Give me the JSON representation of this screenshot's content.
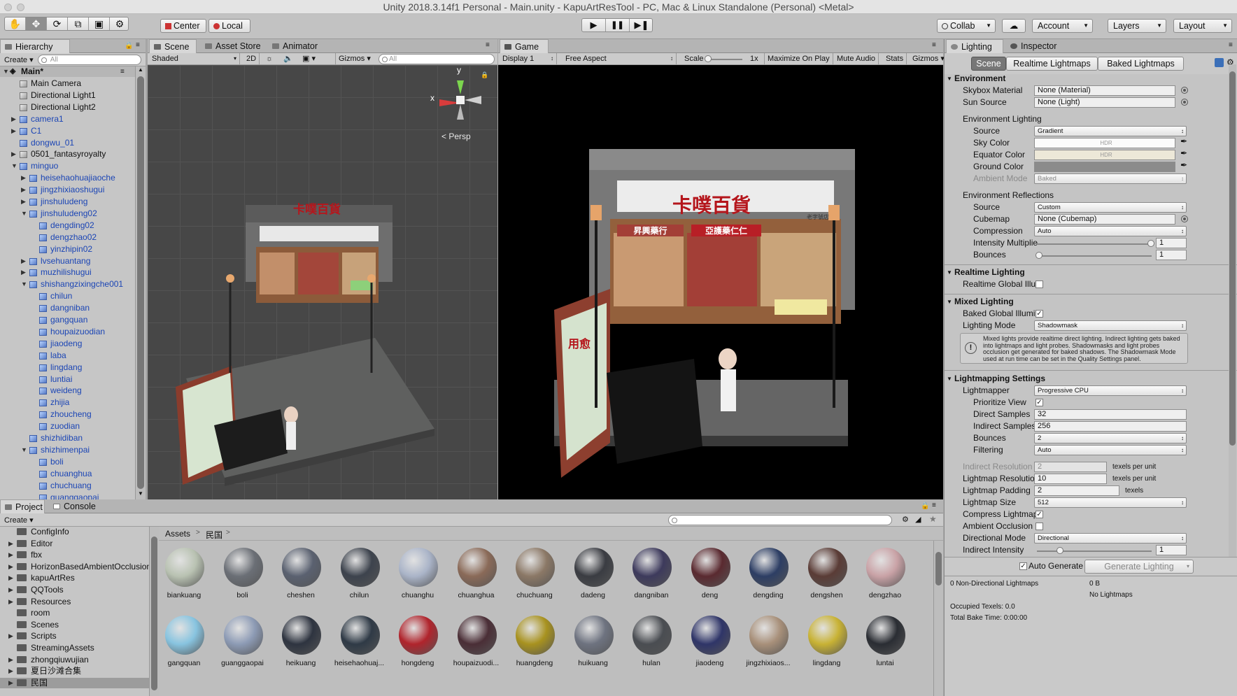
{
  "window": {
    "title": "Unity 2018.3.14f1 Personal - Main.unity - KapuArtResTool - PC, Mac & Linux Standalone (Personal) <Metal>"
  },
  "toolbar": {
    "tools": [
      "hand-icon",
      "move-icon",
      "rotate-icon",
      "scale-icon",
      "rect-icon",
      "transform-icon"
    ],
    "pivot": "Center",
    "space": "Local",
    "collab": "Collab",
    "account": "Account",
    "layers": "Layers",
    "layout": "Layout"
  },
  "hierarchy": {
    "tab": "Hierarchy",
    "create": "Create",
    "search": " All",
    "scene": "Main*",
    "items": [
      {
        "label": "Main Camera",
        "depth": 1,
        "arrow": "",
        "prefab": false
      },
      {
        "label": "Directional Light1",
        "depth": 1,
        "arrow": "",
        "prefab": false
      },
      {
        "label": "Directional Light2",
        "depth": 1,
        "arrow": "",
        "prefab": false
      },
      {
        "label": "camera1",
        "depth": 1,
        "arrow": "r",
        "prefab": true
      },
      {
        "label": "C1",
        "depth": 1,
        "arrow": "r",
        "prefab": true
      },
      {
        "label": "dongwu_01",
        "depth": 1,
        "arrow": "",
        "prefab": true
      },
      {
        "label": "0501_fantasyroyalty",
        "depth": 1,
        "arrow": "r",
        "prefab": false
      },
      {
        "label": "minguo",
        "depth": 1,
        "arrow": "d",
        "prefab": true
      },
      {
        "label": "heisehaohuajiaoche",
        "depth": 2,
        "arrow": "r",
        "prefab": true
      },
      {
        "label": "jingzhixiaoshugui",
        "depth": 2,
        "arrow": "r",
        "prefab": true
      },
      {
        "label": "jinshuludeng",
        "depth": 2,
        "arrow": "r",
        "prefab": true
      },
      {
        "label": "jinshuludeng02",
        "depth": 2,
        "arrow": "d",
        "prefab": true
      },
      {
        "label": "dengding02",
        "depth": 3,
        "arrow": "",
        "prefab": true
      },
      {
        "label": "dengzhao02",
        "depth": 3,
        "arrow": "",
        "prefab": true
      },
      {
        "label": "yinzhipin02",
        "depth": 3,
        "arrow": "",
        "prefab": true
      },
      {
        "label": "lvsehuantang",
        "depth": 2,
        "arrow": "r",
        "prefab": true
      },
      {
        "label": "muzhilishugui",
        "depth": 2,
        "arrow": "r",
        "prefab": true
      },
      {
        "label": "shishangzixingche001",
        "depth": 2,
        "arrow": "d",
        "prefab": true
      },
      {
        "label": "chilun",
        "depth": 3,
        "arrow": "",
        "prefab": true
      },
      {
        "label": "dangniban",
        "depth": 3,
        "arrow": "",
        "prefab": true
      },
      {
        "label": "gangquan",
        "depth": 3,
        "arrow": "",
        "prefab": true
      },
      {
        "label": "houpaizuodian",
        "depth": 3,
        "arrow": "",
        "prefab": true
      },
      {
        "label": "jiaodeng",
        "depth": 3,
        "arrow": "",
        "prefab": true
      },
      {
        "label": "laba",
        "depth": 3,
        "arrow": "",
        "prefab": true
      },
      {
        "label": "lingdang",
        "depth": 3,
        "arrow": "",
        "prefab": true
      },
      {
        "label": "luntiai",
        "depth": 3,
        "arrow": "",
        "prefab": true
      },
      {
        "label": "weideng",
        "depth": 3,
        "arrow": "",
        "prefab": true
      },
      {
        "label": "zhijia",
        "depth": 3,
        "arrow": "",
        "prefab": true
      },
      {
        "label": "zhoucheng",
        "depth": 3,
        "arrow": "",
        "prefab": true
      },
      {
        "label": "zuodian",
        "depth": 3,
        "arrow": "",
        "prefab": true
      },
      {
        "label": "shizhidiban",
        "depth": 2,
        "arrow": "",
        "prefab": true
      },
      {
        "label": "shizhimenpai",
        "depth": 2,
        "arrow": "d",
        "prefab": true
      },
      {
        "label": "boli",
        "depth": 3,
        "arrow": "",
        "prefab": true
      },
      {
        "label": "chuanghua",
        "depth": 3,
        "arrow": "",
        "prefab": true
      },
      {
        "label": "chuchuang",
        "depth": 3,
        "arrow": "",
        "prefab": true
      },
      {
        "label": "guanggaopai",
        "depth": 3,
        "arrow": "",
        "prefab": true
      }
    ]
  },
  "scene": {
    "tabs": [
      "Scene",
      "Asset Store",
      "Animator"
    ],
    "shading": "Shaded",
    "mode2d": "2D",
    "gizmos": "Gizmos",
    "search": "All",
    "persp": "Persp",
    "axis_x": "x",
    "axis_y": "y"
  },
  "game": {
    "tab": "Game",
    "display": "Display 1",
    "aspect": "Free Aspect",
    "scale_label": "Scale",
    "scale_value": "1x",
    "maximize": "Maximize On Play",
    "mute": "Mute Audio",
    "stats": "Stats",
    "gizmos": "Gizmos"
  },
  "sign": {
    "main": "卡噗百貨",
    "small": "老字號店",
    "shop1": "昇興藥行",
    "shop2": "亞護藥仁仁",
    "poster": "用愈"
  },
  "lighting": {
    "tabs": [
      "Lighting",
      "Inspector"
    ],
    "subtabs": [
      "Scene",
      "Realtime Lightmaps",
      "Baked Lightmaps"
    ],
    "environment": {
      "header": "Environment",
      "skybox_label": "Skybox Material",
      "skybox": "None (Material)",
      "sun_label": "Sun Source",
      "sun": "None (Light)",
      "env_lighting": "Environment Lighting",
      "source_label": "Source",
      "source": "Gradient",
      "sky_label": "Sky Color",
      "equator_label": "Equator Color",
      "ground_label": "Ground Color",
      "hdr": "HDR",
      "ambient_label": "Ambient Mode",
      "ambient": "Baked",
      "reflections": "Environment Reflections",
      "rsource_label": "Source",
      "rsource": "Custom",
      "cubemap_label": "Cubemap",
      "cubemap": "None (Cubemap)",
      "compression_label": "Compression",
      "compression": "Auto",
      "intensity_label": "Intensity Multiplie",
      "intensity": "1",
      "bounces_label": "Bounces",
      "bounces": "1"
    },
    "realtime": {
      "header": "Realtime Lighting",
      "gi_label": "Realtime Global Illun",
      "gi": false
    },
    "mixed": {
      "header": "Mixed Lighting",
      "baked_label": "Baked Global Illumin",
      "baked": true,
      "mode_label": "Lighting Mode",
      "mode": "Shadowmask",
      "help": "Mixed lights provide realtime direct lighting. Indirect lighting gets baked into lightmaps and light probes. Shadowmasks and light probes occlusion get generated for baked shadows. The Shadowmask Mode used at run time can be set in the Quality Settings panel."
    },
    "lightmapping": {
      "header": "Lightmapping Settings",
      "lightmapper_label": "Lightmapper",
      "lightmapper": "Progressive CPU",
      "prioritize_label": "Prioritize View",
      "prioritize": true,
      "direct_label": "Direct Samples",
      "direct": "32",
      "indirect_label": "Indirect Samples",
      "indirect": "256",
      "bounces_label": "Bounces",
      "bounces": "2",
      "filtering_label": "Filtering",
      "filtering": "Auto",
      "ires_label": "Indirect Resolution",
      "ires": "2",
      "texels_per_unit": "texels per unit",
      "lres_label": "Lightmap Resolutior",
      "lres": "10",
      "padding_label": "Lightmap Padding",
      "padding": "2",
      "texels": "texels",
      "size_label": "Lightmap Size",
      "size": "512",
      "compress_label": "Compress Lightmap",
      "compress": true,
      "ao_label": "Ambient Occlusion",
      "ao": false,
      "dirmode_label": "Directional Mode",
      "dirmode": "Directional",
      "indint_label": "Indirect Intensity",
      "indint": "1"
    },
    "auto_generate_label": "Auto Generate",
    "auto_generate": true,
    "generate_button": "Generate Lighting",
    "stats": {
      "nondir": "0 Non-Directional Lightmaps",
      "bytes": "0 B",
      "nolightmaps": "No Lightmaps",
      "occupied": "Occupied Texels: 0.0",
      "bake": "Total Bake Time: 0:00:00"
    }
  },
  "project": {
    "tabs": [
      "Project",
      "Console"
    ],
    "create": "Create",
    "breadcrumb": [
      "Assets",
      "民国"
    ],
    "folders": [
      {
        "label": "ConfigInfo",
        "arrow": ""
      },
      {
        "label": "Editor",
        "arrow": "r"
      },
      {
        "label": "fbx",
        "arrow": "r"
      },
      {
        "label": "HorizonBasedAmbientOcclusion",
        "arrow": "r"
      },
      {
        "label": "kapuArtRes",
        "arrow": "r"
      },
      {
        "label": "QQTools",
        "arrow": "r"
      },
      {
        "label": "Resources",
        "arrow": "r"
      },
      {
        "label": "room",
        "arrow": ""
      },
      {
        "label": "Scenes",
        "arrow": ""
      },
      {
        "label": "Scripts",
        "arrow": "r"
      },
      {
        "label": "StreamingAssets",
        "arrow": ""
      },
      {
        "label": "zhongqiuwujian",
        "arrow": "r"
      },
      {
        "label": "夏日沙滩合集",
        "arrow": "r"
      },
      {
        "label": "民国",
        "arrow": "r"
      }
    ],
    "assets_row1": [
      {
        "name": "biankuang",
        "color": "#b9c2b2"
      },
      {
        "name": "boli",
        "color": "#6b6f76"
      },
      {
        "name": "cheshen",
        "color": "#5a6170"
      },
      {
        "name": "chilun",
        "color": "#3d434d"
      },
      {
        "name": "chuanghu",
        "color": "#aab4c8"
      },
      {
        "name": "chuanghua",
        "color": "#8a6a58"
      },
      {
        "name": "chuchuang",
        "color": "#8b7866"
      },
      {
        "name": "dadeng",
        "color": "#3a3c42"
      },
      {
        "name": "dangniban",
        "color": "#3d3a5c"
      },
      {
        "name": "deng",
        "color": "#5a2a30"
      },
      {
        "name": "dengding",
        "color": "#2d3e64"
      },
      {
        "name": "dengshen",
        "color": "#5a3c36"
      },
      {
        "name": "dengzhao",
        "color": "#c9a2a6"
      }
    ],
    "assets_row2": [
      {
        "name": "gangquan",
        "color": "#88c4e0"
      },
      {
        "name": "guanggaopai",
        "color": "#8d9bb5"
      },
      {
        "name": "heikuang",
        "color": "#2e3440"
      },
      {
        "name": "heisehaohuaj...",
        "color": "#2f3a46"
      },
      {
        "name": "hongdeng",
        "color": "#b0242c"
      },
      {
        "name": "houpaizuodi...",
        "color": "#4a2e36"
      },
      {
        "name": "huangdeng",
        "color": "#a8921f"
      },
      {
        "name": "huikuang",
        "color": "#6e7380"
      },
      {
        "name": "hulan",
        "color": "#4a4d52"
      },
      {
        "name": "jiaodeng",
        "color": "#2f3568"
      },
      {
        "name": "jingzhixiaos...",
        "color": "#a8907a"
      },
      {
        "name": "lingdang",
        "color": "#c8b234"
      },
      {
        "name": "luntai",
        "color": "#2a2d33"
      }
    ]
  }
}
